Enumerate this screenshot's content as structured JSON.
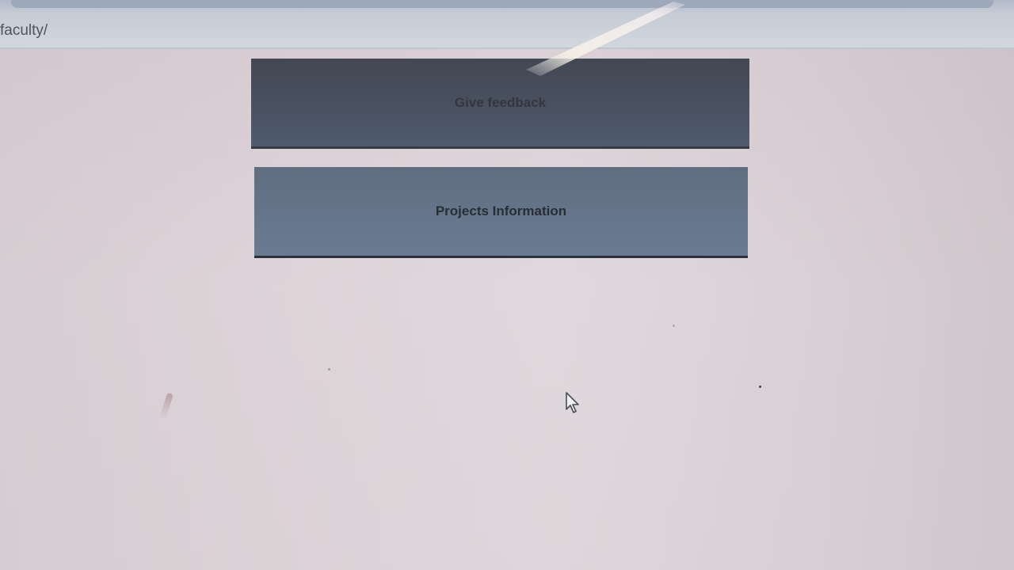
{
  "browser": {
    "address_bar": {
      "url": "faculty/"
    }
  },
  "main": {
    "buttons": [
      {
        "label": "Give feedback"
      },
      {
        "label": "Projects Information"
      }
    ]
  },
  "icons": {
    "cursor": "arrow-cursor-icon"
  },
  "colors": {
    "page_background": "#ddd3d8",
    "address_bar": "#cfdae1",
    "button_dark": "#2c3a4a",
    "button_slate": "#5a6d84"
  }
}
